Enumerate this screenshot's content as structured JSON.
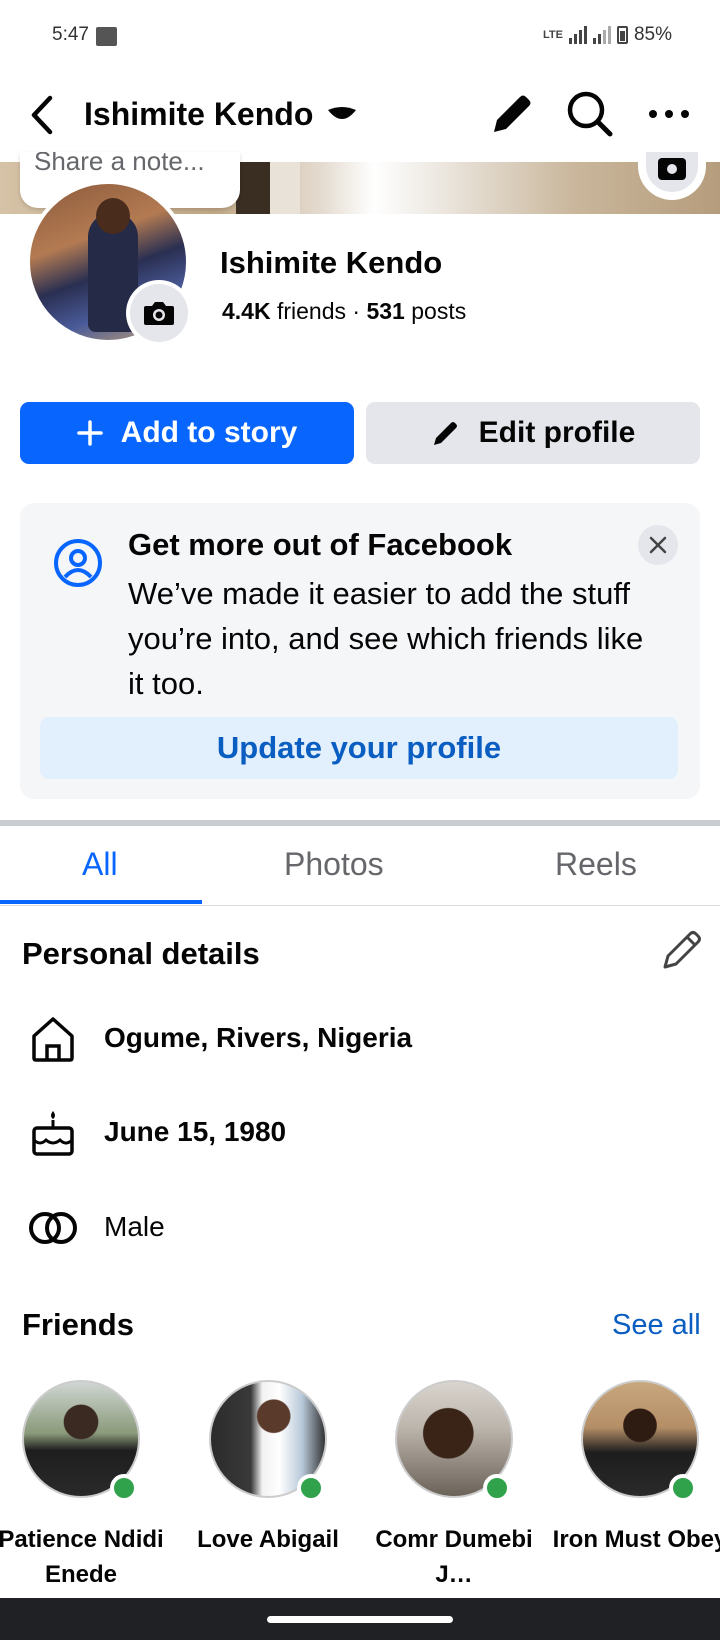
{
  "status_bar": {
    "time": "5:47",
    "battery": "85%",
    "network": "LTE"
  },
  "header": {
    "title": "Ishimite Kendo",
    "icons": [
      "back-arrow-icon",
      "caret-down-icon",
      "pencil-icon",
      "search-icon",
      "more-icon"
    ]
  },
  "cover": {
    "note_placeholder": "Share a note..."
  },
  "profile": {
    "name": "Ishimite Kendo",
    "friends_count": "4.4K",
    "friends_label": " friends · ",
    "posts_count": "531",
    "posts_label": " posts"
  },
  "actions": {
    "add_story": "Add to story",
    "edit_profile": "Edit profile",
    "accent": "#0866ff"
  },
  "promo": {
    "title": "Get more out of Facebook",
    "body": "We’ve made it easier to add the stuff you’re into, and see which friends like it too.",
    "cta": "Update your profile"
  },
  "tabs": [
    {
      "label": "All",
      "active": true
    },
    {
      "label": "Photos",
      "active": false
    },
    {
      "label": "Reels",
      "active": false
    }
  ],
  "personal_details": {
    "title": "Personal details",
    "items": [
      {
        "icon": "home-icon",
        "text": "Ogume, Rivers, Nigeria"
      },
      {
        "icon": "birthday-cake-icon",
        "text": "June 15, 1980"
      },
      {
        "icon": "gender-rings-icon",
        "text": "Male"
      }
    ]
  },
  "friends": {
    "title": "Friends",
    "see_all": "See all",
    "items": [
      {
        "name": "Patience Ndidi Enede",
        "online": true
      },
      {
        "name": "Love Abigail",
        "online": true
      },
      {
        "name": "Comr Dumebi J…",
        "online": true
      },
      {
        "name": "Iron Must Obey",
        "online": true
      }
    ]
  }
}
